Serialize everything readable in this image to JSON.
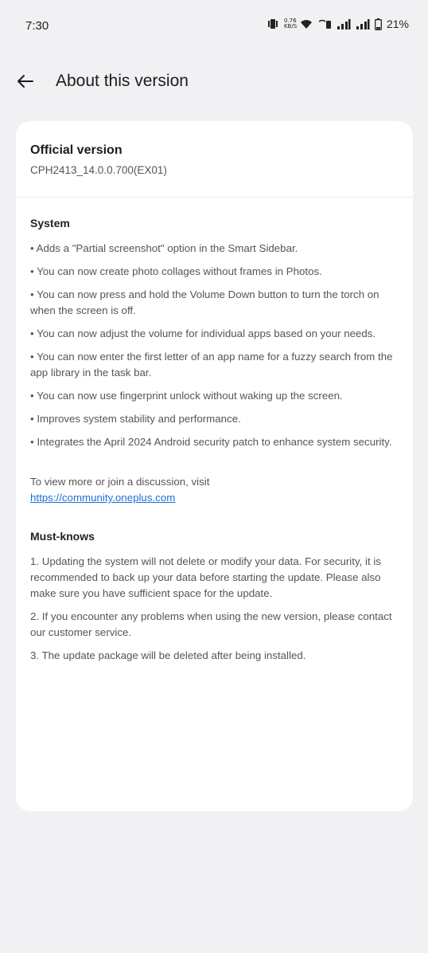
{
  "status_bar": {
    "time": "7:30",
    "net_speed": "0.76 KB/S",
    "net_speed_top": "0.76",
    "net_speed_bottom": "KB/S",
    "battery": "21%",
    "icons": [
      "vibrate-icon",
      "wifi-icon",
      "volte-icon",
      "signal-icon",
      "signal-icon",
      "battery-icon"
    ]
  },
  "header": {
    "title": "About this version"
  },
  "version": {
    "title": "Official version",
    "code": "CPH2413_14.0.0.700(EX01)"
  },
  "system": {
    "title": "System",
    "items": [
      "• Adds a \"Partial screenshot\" option in the Smart Sidebar.",
      "• You can now create photo collages without frames in Photos.",
      "• You can now press and hold the Volume Down button to turn the torch on when the screen is off.",
      "• You can now adjust the volume for individual apps based on your needs.",
      "• You can now enter the first letter of an app name for a fuzzy search from the app library in the task bar.",
      "• You can now use fingerprint unlock without waking up the screen.",
      "• Improves system stability and performance.",
      "• Integrates the April 2024 Android security patch to enhance system security."
    ]
  },
  "discussion": {
    "text": "To view more or join a discussion, visit",
    "link": "https://community.oneplus.com"
  },
  "must_knows": {
    "title": "Must-knows",
    "items": [
      "1. Updating the system will not delete or modify your data. For security, it is recommended to back up your data before starting the update. Please also make sure you have sufficient space for the update.",
      "2. If you encounter any problems when using the new version, please contact our customer service.",
      "3. The update package will be deleted after being installed."
    ]
  }
}
